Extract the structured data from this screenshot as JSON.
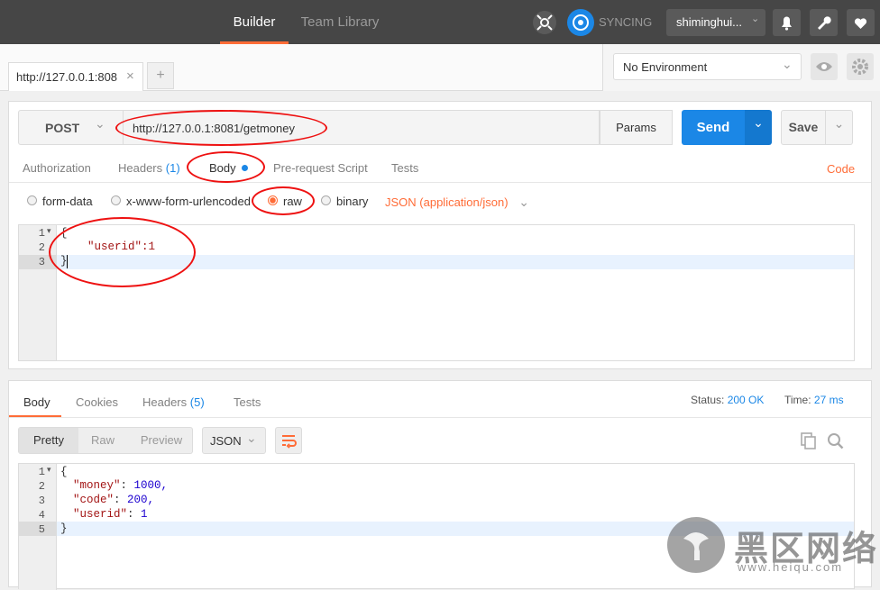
{
  "nav": {
    "builder": "Builder",
    "team_library": "Team Library",
    "syncing": "SYNCING",
    "user": "shiminghui..."
  },
  "tabs": {
    "active_tab": "http://127.0.0.1:808",
    "close": "×",
    "new_tab": "+"
  },
  "environment": {
    "selected": "No Environment"
  },
  "request": {
    "method": "POST",
    "url": "http://127.0.0.1:8081/getmoney",
    "params": "Params",
    "send": "Send",
    "save": "Save",
    "subtabs": {
      "authorization": "Authorization",
      "headers": "Headers",
      "headers_count": "(1)",
      "body": "Body",
      "prerequest": "Pre-request Script",
      "tests": "Tests",
      "code": "Code"
    },
    "body_modes": {
      "form_data": "form-data",
      "urlencoded": "x-www-form-urlencoded",
      "raw": "raw",
      "binary": "binary",
      "content_type": "JSON (application/json)"
    },
    "editor_lines": [
      "{",
      "    \"userid\":1",
      "}"
    ],
    "line_numbers": [
      "1",
      "2",
      "3"
    ]
  },
  "response": {
    "tabs": {
      "body": "Body",
      "cookies": "Cookies",
      "headers": "Headers",
      "headers_count": "(5)",
      "tests": "Tests"
    },
    "status_label": "Status:",
    "status_value": "200 OK",
    "time_label": "Time:",
    "time_value": "27 ms",
    "view_modes": {
      "pretty": "Pretty",
      "raw": "Raw",
      "preview": "Preview",
      "format": "JSON"
    },
    "line_numbers": [
      "1",
      "2",
      "3",
      "4",
      "5"
    ],
    "lines": [
      {
        "key": "",
        "value": "{"
      },
      {
        "key": "\"money\"",
        "value": "1000,"
      },
      {
        "key": "\"code\"",
        "value": "200,"
      },
      {
        "key": "\"userid\"",
        "value": "1"
      },
      {
        "key": "",
        "value": "}"
      }
    ]
  },
  "watermark": {
    "text": "黑区网络",
    "url": "www.heiqu.com"
  },
  "colors": {
    "accent": "#ff6c37",
    "send_blue": "#1b87e6",
    "annotation_red": "#e11111",
    "dark_bar": "#464646"
  }
}
